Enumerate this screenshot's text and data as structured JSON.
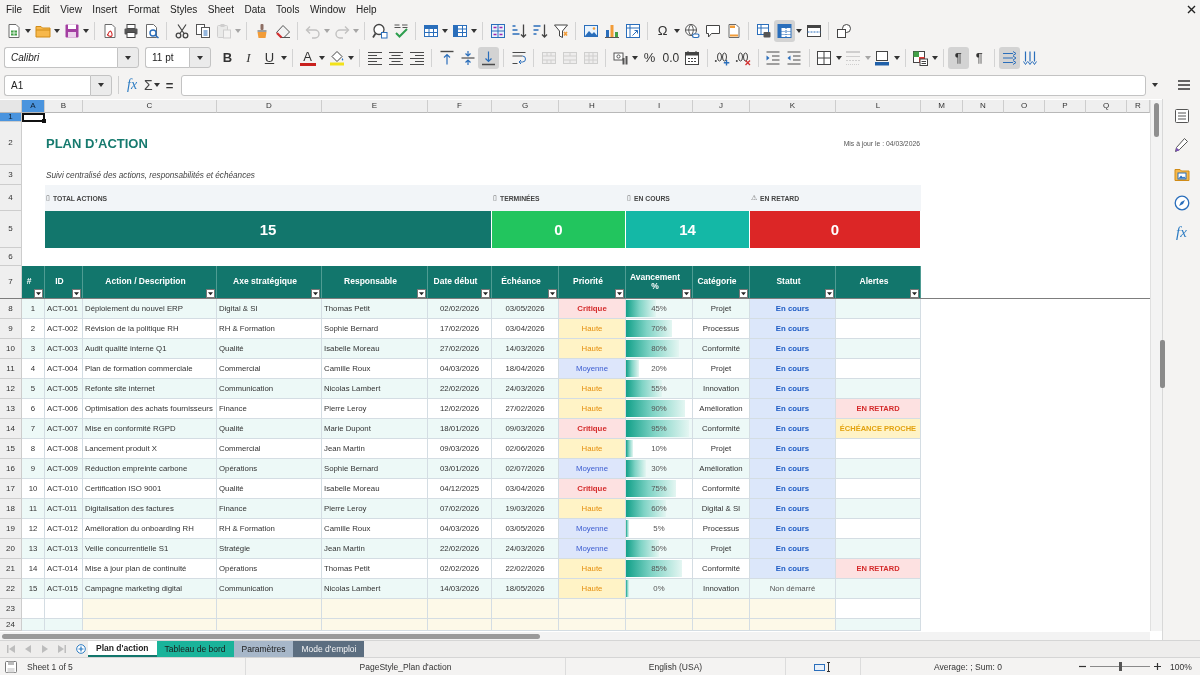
{
  "menu": [
    "File",
    "Edit",
    "View",
    "Insert",
    "Format",
    "Styles",
    "Sheet",
    "Data",
    "Tools",
    "Window",
    "Help"
  ],
  "toolbar_standard": [
    [
      {
        "kind": "new",
        "pressed": false,
        "disabled": false,
        "menu": true
      },
      {
        "kind": "open",
        "pressed": false,
        "disabled": false,
        "menu": true
      },
      {
        "kind": "save",
        "pressed": false,
        "disabled": false,
        "menu": true
      }
    ],
    [
      {
        "kind": "pdf",
        "pressed": false,
        "disabled": false,
        "menu": false
      },
      {
        "kind": "print",
        "pressed": false,
        "disabled": false,
        "menu": false
      },
      {
        "kind": "preview",
        "pressed": false,
        "disabled": false,
        "menu": false
      }
    ],
    [
      {
        "kind": "cut",
        "pressed": false,
        "disabled": false,
        "menu": false
      },
      {
        "kind": "copy",
        "pressed": false,
        "disabled": false,
        "menu": false
      },
      {
        "kind": "paste",
        "pressed": false,
        "disabled": true,
        "menu": true
      }
    ],
    [
      {
        "kind": "clone",
        "pressed": false,
        "disabled": false,
        "menu": false
      },
      {
        "kind": "clear",
        "pressed": false,
        "disabled": false,
        "menu": false
      }
    ],
    [
      {
        "kind": "undo",
        "pressed": false,
        "disabled": true,
        "menu": true
      },
      {
        "kind": "redo",
        "pressed": false,
        "disabled": true,
        "menu": true
      }
    ],
    [
      {
        "kind": "find",
        "pressed": false,
        "disabled": false,
        "menu": false
      },
      {
        "kind": "spell",
        "pressed": false,
        "disabled": false,
        "menu": false
      }
    ],
    [
      {
        "kind": "rows",
        "pressed": false,
        "disabled": false,
        "menu": true
      },
      {
        "kind": "cols",
        "pressed": false,
        "disabled": false,
        "menu": true
      }
    ],
    [
      {
        "kind": "sort",
        "pressed": false,
        "disabled": false,
        "menu": false
      },
      {
        "kind": "sort-asc",
        "pressed": false,
        "disabled": false,
        "menu": false
      },
      {
        "kind": "sort-desc",
        "pressed": false,
        "disabled": false,
        "menu": false
      },
      {
        "kind": "filter",
        "pressed": false,
        "disabled": false,
        "menu": false
      }
    ],
    [
      {
        "kind": "image",
        "pressed": false,
        "disabled": false,
        "menu": false
      },
      {
        "kind": "chart",
        "pressed": false,
        "disabled": false,
        "menu": false
      },
      {
        "kind": "pivot",
        "pressed": false,
        "disabled": false,
        "menu": false
      }
    ],
    [
      {
        "kind": "special",
        "glyph": "Ω",
        "pressed": false,
        "disabled": false,
        "menu": true
      },
      {
        "kind": "link",
        "pressed": false,
        "disabled": false,
        "menu": false
      },
      {
        "kind": "comment",
        "pressed": false,
        "disabled": false,
        "menu": false
      },
      {
        "kind": "header-footer",
        "pressed": false,
        "disabled": false,
        "menu": false
      }
    ],
    [
      {
        "kind": "print-range",
        "pressed": false,
        "disabled": false,
        "menu": false
      },
      {
        "kind": "freeze",
        "pressed": true,
        "disabled": false,
        "menu": true
      },
      {
        "kind": "split",
        "pressed": false,
        "disabled": false,
        "menu": false
      }
    ],
    [
      {
        "kind": "draw",
        "pressed": false,
        "disabled": false,
        "menu": false
      }
    ]
  ],
  "toolbar_format": {
    "font_name": "Calibri",
    "font_size": "11 pt",
    "groups": [
      [
        {
          "kind": "bold",
          "glyph": "B",
          "pressed": false,
          "disabled": false,
          "menu": false
        },
        {
          "kind": "italic",
          "glyph": "I",
          "pressed": false,
          "disabled": false,
          "menu": false
        },
        {
          "kind": "underline",
          "glyph": "U",
          "pressed": false,
          "disabled": false,
          "menu": true
        }
      ],
      [
        {
          "kind": "font-color",
          "glyph": "A",
          "pressed": false,
          "disabled": false,
          "menu": true
        },
        {
          "kind": "highlight",
          "pressed": false,
          "disabled": false,
          "menu": true
        }
      ],
      [
        {
          "kind": "align-left",
          "pressed": false,
          "disabled": false,
          "menu": false
        },
        {
          "kind": "align-center",
          "pressed": false,
          "disabled": false,
          "menu": false
        },
        {
          "kind": "align-right",
          "pressed": false,
          "disabled": false,
          "menu": false
        }
      ],
      [
        {
          "kind": "align-top",
          "pressed": false,
          "disabled": false,
          "menu": false
        },
        {
          "kind": "align-middle",
          "pressed": false,
          "disabled": false,
          "menu": false
        },
        {
          "kind": "align-bottom",
          "pressed": true,
          "disabled": false,
          "menu": false
        }
      ],
      [
        {
          "kind": "wrap",
          "pressed": false,
          "disabled": false,
          "menu": false
        }
      ],
      [
        {
          "kind": "merge-center",
          "pressed": false,
          "disabled": true,
          "menu": false
        },
        {
          "kind": "merge",
          "pressed": false,
          "disabled": true,
          "menu": false
        },
        {
          "kind": "unmerge",
          "pressed": false,
          "disabled": true,
          "menu": false
        }
      ],
      [
        {
          "kind": "number-format",
          "pressed": false,
          "disabled": false,
          "menu": true
        },
        {
          "kind": "percent",
          "glyph": "%",
          "pressed": false,
          "disabled": false,
          "menu": false
        },
        {
          "kind": "number",
          "glyph": "0.0",
          "pressed": false,
          "disabled": false,
          "menu": false
        },
        {
          "kind": "date",
          "pressed": false,
          "disabled": false,
          "menu": false
        }
      ],
      [
        {
          "kind": "add-decimal",
          "pressed": false,
          "disabled": false,
          "menu": false
        },
        {
          "kind": "delete-decimal",
          "pressed": false,
          "disabled": false,
          "menu": false
        }
      ],
      [
        {
          "kind": "indent",
          "pressed": false,
          "disabled": false,
          "menu": false
        },
        {
          "kind": "outdent",
          "pressed": false,
          "disabled": false,
          "menu": false
        }
      ],
      [
        {
          "kind": "borders",
          "pressed": false,
          "disabled": false,
          "menu": true
        },
        {
          "kind": "border-style",
          "pressed": false,
          "disabled": true,
          "menu": true
        },
        {
          "kind": "border-color",
          "pressed": false,
          "disabled": false,
          "menu": true
        }
      ],
      [
        {
          "kind": "conditional",
          "pressed": false,
          "disabled": false,
          "menu": true
        }
      ],
      [
        {
          "kind": "para-ltr",
          "glyph": "¶",
          "pressed": true,
          "disabled": false,
          "menu": false
        },
        {
          "kind": "para-rtl",
          "glyph": "¶",
          "pressed": false,
          "disabled": false,
          "menu": false
        }
      ],
      [
        {
          "kind": "text-ltr",
          "pressed": true,
          "disabled": false,
          "menu": false
        },
        {
          "kind": "text-ttb",
          "pressed": false,
          "disabled": false,
          "menu": false
        }
      ]
    ]
  },
  "formula_bar": {
    "cell": "A1",
    "wizard": "fx",
    "sum": "Σ",
    "equals": "="
  },
  "sidebar": {
    "functions": "fx"
  },
  "column_headers": [
    {
      "label": "A",
      "selected": true
    },
    {
      "label": "B",
      "selected": false
    },
    {
      "label": "C",
      "selected": false
    },
    {
      "label": "D",
      "selected": false
    },
    {
      "label": "E",
      "selected": false
    },
    {
      "label": "F",
      "selected": false
    },
    {
      "label": "G",
      "selected": false
    },
    {
      "label": "H",
      "selected": false
    },
    {
      "label": "I",
      "selected": false
    },
    {
      "label": "J",
      "selected": false
    },
    {
      "label": "K",
      "selected": false
    },
    {
      "label": "L",
      "selected": false
    },
    {
      "label": "M",
      "selected": false
    },
    {
      "label": "N",
      "selected": false
    },
    {
      "label": "O",
      "selected": false
    },
    {
      "label": "P",
      "selected": false
    },
    {
      "label": "Q",
      "selected": false
    },
    {
      "label": "R",
      "selected": false
    }
  ],
  "row_headers": [
    {
      "label": "1",
      "selected": true
    },
    {
      "label": "2",
      "selected": false
    },
    {
      "label": "3",
      "selected": false
    },
    {
      "label": "4",
      "selected": false
    },
    {
      "label": "5",
      "selected": false
    },
    {
      "label": "6",
      "selected": false
    },
    {
      "label": "7",
      "selected": false
    },
    {
      "label": "8",
      "selected": false
    },
    {
      "label": "9",
      "selected": false
    },
    {
      "label": "10",
      "selected": false
    },
    {
      "label": "11",
      "selected": false
    },
    {
      "label": "12",
      "selected": false
    },
    {
      "label": "13",
      "selected": false
    },
    {
      "label": "14",
      "selected": false
    },
    {
      "label": "15",
      "selected": false
    },
    {
      "label": "16",
      "selected": false
    },
    {
      "label": "17",
      "selected": false
    },
    {
      "label": "18",
      "selected": false
    },
    {
      "label": "19",
      "selected": false
    },
    {
      "label": "20",
      "selected": false
    },
    {
      "label": "21",
      "selected": false
    },
    {
      "label": "22",
      "selected": false
    },
    {
      "label": "23",
      "selected": false
    },
    {
      "label": "24",
      "selected": false
    }
  ],
  "sheet": {
    "title": "PLAN D’ACTION",
    "updated": "Mis à jour le : 04/03/2026",
    "subtitle": "Suivi centralisé des actions, responsabilités et échéances",
    "kpis": [
      {
        "glyph": "▯",
        "label": "TOTAL ACTIONS",
        "value": "15",
        "color": "#12766c"
      },
      {
        "glyph": "▯",
        "label": "TERMINÉES",
        "value": "0",
        "color": "#22c55e"
      },
      {
        "glyph": "▯",
        "label": "EN COURS",
        "value": "14",
        "color": "#14b8a6"
      },
      {
        "glyph": "⚠",
        "label": "EN RETARD",
        "value": "0",
        "color": "#dc2626"
      }
    ],
    "table": {
      "columns": [
        "#",
        "ID",
        "Action / Description",
        "Axe stratégique",
        "Responsable",
        "Date début",
        "Échéance",
        "Priorité",
        "Avancement %",
        "Catégorie",
        "Statut",
        "Alertes"
      ],
      "rows": [
        {
          "num": "1",
          "id": "ACT-001",
          "action": "Déploiement du nouvel ERP",
          "axis": "Digital & SI",
          "owner": "Thomas Petit",
          "start": "02/02/2026",
          "due": "03/05/2026",
          "priority": {
            "text": "Critique",
            "kind": "critical"
          },
          "progress": {
            "text": "45%",
            "level": 0.45
          },
          "category": "Projet",
          "status": {
            "text": "En cours",
            "kind": "active"
          }
        },
        {
          "num": "2",
          "id": "ACT-002",
          "action": "Révision de la politique RH",
          "axis": "RH & Formation",
          "owner": "Sophie Bernard",
          "start": "17/02/2026",
          "due": "03/04/2026",
          "priority": {
            "text": "Haute",
            "kind": "high"
          },
          "progress": {
            "text": "70%",
            "level": 0.7
          },
          "category": "Processus",
          "status": {
            "text": "En cours",
            "kind": "active"
          }
        },
        {
          "num": "3",
          "id": "ACT-003",
          "action": "Audit qualité interne Q1",
          "axis": "Qualité",
          "owner": "Isabelle Moreau",
          "start": "27/02/2026",
          "due": "14/03/2026",
          "priority": {
            "text": "Haute",
            "kind": "high"
          },
          "progress": {
            "text": "80%",
            "level": 0.8
          },
          "category": "Conformité",
          "status": {
            "text": "En cours",
            "kind": "active"
          }
        },
        {
          "num": "4",
          "id": "ACT-004",
          "action": "Plan de formation commerciale",
          "axis": "Commercial",
          "owner": "Camille Roux",
          "start": "04/03/2026",
          "due": "18/04/2026",
          "priority": {
            "text": "Moyenne",
            "kind": "medium"
          },
          "progress": {
            "text": "20%",
            "level": 0.2
          },
          "category": "Projet",
          "status": {
            "text": "En cours",
            "kind": "active"
          }
        },
        {
          "num": "5",
          "id": "ACT-005",
          "action": "Refonte site internet",
          "axis": "Communication",
          "owner": "Nicolas Lambert",
          "start": "22/02/2026",
          "due": "24/03/2026",
          "priority": {
            "text": "Haute",
            "kind": "high"
          },
          "progress": {
            "text": "55%",
            "level": 0.55
          },
          "category": "Innovation",
          "status": {
            "text": "En cours",
            "kind": "active"
          }
        },
        {
          "num": "6",
          "id": "ACT-006",
          "action": "Optimisation des achats fournisseurs",
          "axis": "Finance",
          "owner": "Pierre Leroy",
          "start": "12/02/2026",
          "due": "27/02/2026",
          "priority": {
            "text": "Haute",
            "kind": "high"
          },
          "progress": {
            "text": "90%",
            "level": 0.9
          },
          "category": "Amélioration",
          "status": {
            "text": "En cours",
            "kind": "active"
          },
          "alert": {
            "text": "EN RETARD",
            "kind": "late"
          }
        },
        {
          "num": "7",
          "id": "ACT-007",
          "action": "Mise en conformité RGPD",
          "axis": "Qualité",
          "owner": "Marie Dupont",
          "start": "18/01/2026",
          "due": "09/03/2026",
          "priority": {
            "text": "Critique",
            "kind": "critical"
          },
          "progress": {
            "text": "95%",
            "level": 0.95
          },
          "category": "Conformité",
          "status": {
            "text": "En cours",
            "kind": "active"
          },
          "alert": {
            "text": "ÉCHÉANCE PROCHE",
            "kind": "soon"
          }
        },
        {
          "num": "8",
          "id": "ACT-008",
          "action": "Lancement produit X",
          "axis": "Commercial",
          "owner": "Jean Martin",
          "start": "09/03/2026",
          "due": "02/06/2026",
          "priority": {
            "text": "Haute",
            "kind": "high"
          },
          "progress": {
            "text": "10%",
            "level": 0.1
          },
          "category": "Projet",
          "status": {
            "text": "En cours",
            "kind": "active"
          }
        },
        {
          "num": "9",
          "id": "ACT-009",
          "action": "Réduction empreinte carbone",
          "axis": "Opérations",
          "owner": "Sophie Bernard",
          "start": "03/01/2026",
          "due": "02/07/2026",
          "priority": {
            "text": "Moyenne",
            "kind": "medium"
          },
          "progress": {
            "text": "30%",
            "level": 0.3
          },
          "category": "Amélioration",
          "status": {
            "text": "En cours",
            "kind": "active"
          }
        },
        {
          "num": "10",
          "id": "ACT-010",
          "action": "Certification ISO 9001",
          "axis": "Qualité",
          "owner": "Isabelle Moreau",
          "start": "04/12/2025",
          "due": "03/04/2026",
          "priority": {
            "text": "Critique",
            "kind": "critical"
          },
          "progress": {
            "text": "75%",
            "level": 0.75
          },
          "category": "Conformité",
          "status": {
            "text": "En cours",
            "kind": "active"
          }
        },
        {
          "num": "11",
          "id": "ACT-011",
          "action": "Digitalisation des factures",
          "axis": "Finance",
          "owner": "Pierre Leroy",
          "start": "07/02/2026",
          "due": "19/03/2026",
          "priority": {
            "text": "Haute",
            "kind": "high"
          },
          "progress": {
            "text": "60%",
            "level": 0.6
          },
          "category": "Digital & SI",
          "status": {
            "text": "En cours",
            "kind": "active"
          }
        },
        {
          "num": "12",
          "id": "ACT-012",
          "action": "Amélioration du onboarding RH",
          "axis": "RH & Formation",
          "owner": "Camille Roux",
          "start": "04/03/2026",
          "due": "03/05/2026",
          "priority": {
            "text": "Moyenne",
            "kind": "medium"
          },
          "progress": {
            "text": "5%",
            "level": 0.05
          },
          "category": "Processus",
          "status": {
            "text": "En cours",
            "kind": "active"
          }
        },
        {
          "num": "13",
          "id": "ACT-013",
          "action": "Veille concurrentielle S1",
          "axis": "Stratégie",
          "owner": "Jean Martin",
          "start": "22/02/2026",
          "due": "24/03/2026",
          "priority": {
            "text": "Moyenne",
            "kind": "medium"
          },
          "progress": {
            "text": "50%",
            "level": 0.5
          },
          "category": "Projet",
          "status": {
            "text": "En cours",
            "kind": "active"
          }
        },
        {
          "num": "14",
          "id": "ACT-014",
          "action": "Mise à jour plan de continuité",
          "axis": "Opérations",
          "owner": "Thomas Petit",
          "start": "02/02/2026",
          "due": "22/02/2026",
          "priority": {
            "text": "Haute",
            "kind": "high"
          },
          "progress": {
            "text": "85%",
            "level": 0.85
          },
          "category": "Conformité",
          "status": {
            "text": "En cours",
            "kind": "active"
          },
          "alert": {
            "text": "EN RETARD",
            "kind": "late"
          }
        },
        {
          "num": "15",
          "id": "ACT-015",
          "action": "Campagne marketing digital",
          "axis": "Communication",
          "owner": "Nicolas Lambert",
          "start": "14/03/2026",
          "due": "18/05/2026",
          "priority": {
            "text": "Haute",
            "kind": "high"
          },
          "progress": {
            "text": "0%",
            "level": 0
          },
          "category": "Innovation",
          "status": {
            "text": "Non démarré",
            "kind": "idle"
          }
        }
      ]
    }
  },
  "sheet_nav": [
    {
      "kind": "first",
      "disabled": true
    },
    {
      "kind": "prev",
      "disabled": true
    },
    {
      "kind": "next",
      "disabled": true
    },
    {
      "kind": "last",
      "disabled": true
    }
  ],
  "sheet_tabs": [
    {
      "label": "Plan d'action",
      "selected": true,
      "color": "#12766c"
    },
    {
      "label": "Tableau de bord",
      "selected": false,
      "color": "#1ab39a"
    },
    {
      "label": "Paramètres",
      "selected": false,
      "color": "#a7b7c9"
    },
    {
      "label": "Mode d'emploi",
      "selected": false,
      "color": "#5c6e80"
    }
  ],
  "status_bar": {
    "sheet": "Sheet 1 of 5",
    "page_style": "PageStyle_Plan d'action",
    "language": "English (USA)",
    "summary": "Average: ; Sum: 0",
    "zoom_slider": {
      "level": 0.5
    },
    "zoom": "100%"
  }
}
